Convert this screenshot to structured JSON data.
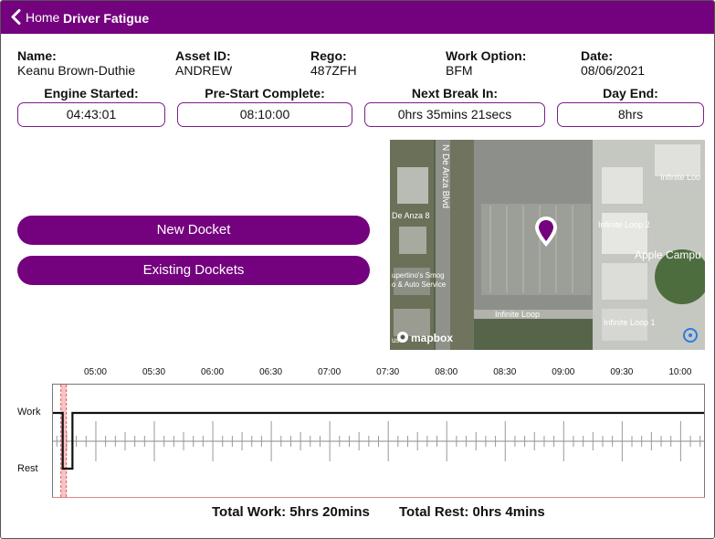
{
  "header": {
    "back_label": "Home",
    "title": "Driver Fatigue",
    "back_icon": "chevron-left-icon",
    "color": "#74017e"
  },
  "info": {
    "name_label": "Name:",
    "name_value": "Keanu Brown-Duthie",
    "asset_label": "Asset ID:",
    "asset_value": "ANDREW",
    "rego_label": "Rego:",
    "rego_value": "487ZFH",
    "work_option_label": "Work Option:",
    "work_option_value": "BFM",
    "date_label": "Date:",
    "date_value": "08/06/2021"
  },
  "status": {
    "engine_started_label": "Engine Started:",
    "engine_started_value": "04:43:01",
    "prestart_label": "Pre-Start Complete:",
    "prestart_value": "08:10:00",
    "next_break_label": "Next Break In:",
    "next_break_value": "0hrs 35mins 21secs",
    "day_end_label": "Day End:",
    "day_end_value": "8hrs"
  },
  "actions": {
    "new_docket": "New Docket",
    "existing_dockets": "Existing Dockets"
  },
  "map": {
    "labels": {
      "street": "N De Anza Blvd",
      "de_anza": "De Anza 8",
      "smog_1": "upertino's Smog",
      "smog_2": "o & Auto Service",
      "il2": "Infinite Loop 2",
      "apple": "Apple Campu",
      "il_road": "Infinite Loop",
      "il1": "Infinite Loop 1",
      "il_top": "Infinite Loo",
      "attribution": "mapbox",
      "partial": "use"
    }
  },
  "timeline": {
    "ticks": [
      "05:00",
      "05:30",
      "06:00",
      "06:30",
      "07:00",
      "07:30",
      "08:00",
      "08:30",
      "09:00",
      "09:30",
      "10:00"
    ],
    "y_work": "Work",
    "y_rest": "Rest",
    "x_start": "04:38",
    "x_end": "10:12",
    "segments": [
      {
        "state": "Work",
        "from": "04:38",
        "to": "04:43"
      },
      {
        "state": "Rest",
        "from": "04:43",
        "to": "04:48"
      },
      {
        "state": "Work",
        "from": "04:48",
        "to": "10:12"
      }
    ],
    "marker_time": "04:43",
    "line_color": "#111111",
    "marker_color": "#e05555"
  },
  "totals": {
    "work": "Total Work: 5hrs 20mins",
    "rest": "Total Rest: 0hrs 4mins"
  }
}
